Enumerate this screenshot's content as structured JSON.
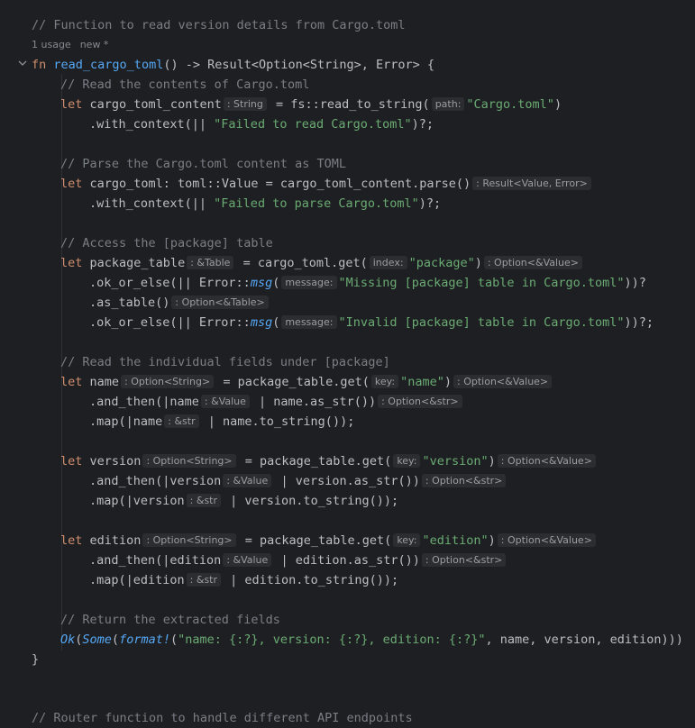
{
  "editor": {
    "top_comment": "// Function to read version details from Cargo.toml",
    "meta": {
      "usages": "1 usage",
      "status": "new *"
    },
    "code": {
      "l1": {
        "fn": "fn",
        "name": "read_cargo_toml",
        "rest": "() -> Result<Option<String>, Error> {"
      },
      "l2": "// Read the contents of Cargo.toml",
      "l3": {
        "let": "let",
        "var": "cargo_toml_content",
        "hint": ": String",
        "mid": " = fs::read_to_string(",
        "param": "path:",
        "str": "\"Cargo.toml\"",
        "end": ")"
      },
      "l4": {
        "pre": ".with_context(|| ",
        "str": "\"Failed to read Cargo.toml\"",
        "end": ")?;"
      },
      "l5": "// Parse the Cargo.toml content as TOML",
      "l6": {
        "let": "let",
        "mid": " cargo_toml: toml::Value = cargo_toml_content.parse()",
        "hint": ": Result<Value, Error>"
      },
      "l7": {
        "pre": ".with_context(|| ",
        "str": "\"Failed to parse Cargo.toml\"",
        "end": ")?;"
      },
      "l8": "// Access the [package] table",
      "l9": {
        "let": "let",
        "var": "package_table",
        "hint": ": &Table",
        "mid": " = cargo_toml.get(",
        "param": "index:",
        "str": "\"package\"",
        "end": ")",
        "hint2": ": Option<&Value>"
      },
      "l10": {
        "pre": ".ok_or_else(|| Error::",
        "msg": "msg",
        "lp": "(",
        "param": "message:",
        "str": "\"Missing [package] table in Cargo.toml\"",
        "end": "))?"
      },
      "l11": {
        "pre": ".as_table()",
        "hint": ": Option<&Table>"
      },
      "l12": {
        "pre": ".ok_or_else(|| Error::",
        "msg": "msg",
        "lp": "(",
        "param": "message:",
        "str": "\"Invalid [package] table in Cargo.toml\"",
        "end": "))?;"
      },
      "l13": "// Read the individual fields under [package]",
      "l14": {
        "let": "let",
        "var": "name",
        "hint": ": Option<String>",
        "mid": " = package_table.get(",
        "param": "key:",
        "str": "\"name\"",
        "end": ")",
        "hint2": ": Option<&Value>"
      },
      "l15": {
        "pre": ".and_then(|name",
        "hint": ": &Value",
        "mid": " | name.as_str())",
        "hint2": ": Option<&str>"
      },
      "l16": {
        "pre": ".map(|name",
        "hint": ": &str",
        "end": " | name.to_string());"
      },
      "l17": {
        "let": "let",
        "var": "version",
        "hint": ": Option<String>",
        "mid": " = package_table.get(",
        "param": "key:",
        "str": "\"version\"",
        "end": ")",
        "hint2": ": Option<&Value>"
      },
      "l18": {
        "pre": ".and_then(|version",
        "hint": ": &Value",
        "mid": " | version.as_str())",
        "hint2": ": Option<&str>"
      },
      "l19": {
        "pre": ".map(|version",
        "hint": ": &str",
        "end": " | version.to_string());"
      },
      "l20": {
        "let": "let",
        "var": "edition",
        "hint": ": Option<String>",
        "mid": " = package_table.get(",
        "param": "key:",
        "str": "\"edition\"",
        "end": ")",
        "hint2": ": Option<&Value>"
      },
      "l21": {
        "pre": ".and_then(|edition",
        "hint": ": &Value",
        "mid": " | edition.as_str())",
        "hint2": ": Option<&str>"
      },
      "l22": {
        "pre": ".map(|edition",
        "hint": ": &str",
        "end": " | edition.to_string());"
      },
      "l23": "// Return the extracted fields",
      "l24": {
        "ok": "Ok",
        "lp1": "(",
        "some": "Some",
        "lp2": "(",
        "fmt": "format!",
        "lp3": "(",
        "str": "\"name: {:?}, version: {:?}, edition: {:?}\"",
        "end": ", name, version, edition)))"
      },
      "l25": "}",
      "bottom_comment": "// Router function to handle different API endpoints"
    }
  },
  "colors": {
    "background": "#1e1f22",
    "keyword": "#cf8e6d",
    "function": "#56a8f5",
    "string": "#6aab73",
    "comment": "#7a7e85"
  },
  "icons": {
    "fold": "chevron-down-icon"
  }
}
